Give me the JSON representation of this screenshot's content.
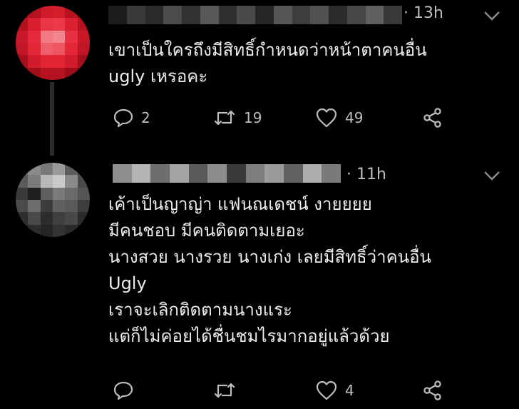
{
  "tweets": [
    {
      "time": "· 13h",
      "lines": [
        "เขาเป็นใครถึงมีสิทธิ์กำหนดว่าหน้าตาคนอื่น",
        "ugly เหรอคะ"
      ],
      "replies": "2",
      "retweets": "19",
      "likes": "49"
    },
    {
      "time": "· 11h",
      "lines": [
        "เค้าเป็นญาญ่า แฟนณเดชน์ งายยยย",
        "มีคนชอบ มีคนติดตามเยอะ",
        "นางสวย นางรวย นางเก่ง เลยมีสิทธิ์ว่าคนอื่น",
        "Ugly",
        "เราจะเลิกติดตามนางแระ",
        "แต่ก็ไม่ค่อยได้ชื่นชมไรมากอยู่แล้วด้วย"
      ],
      "replies": "",
      "retweets": "",
      "likes": "4"
    }
  ],
  "icons": [
    "chevron-down-icon",
    "reply-icon",
    "retweet-icon",
    "like-icon",
    "share-icon"
  ],
  "colors": {
    "background": "#000000",
    "text": "#ececec",
    "muted": "#bdbdbd"
  }
}
